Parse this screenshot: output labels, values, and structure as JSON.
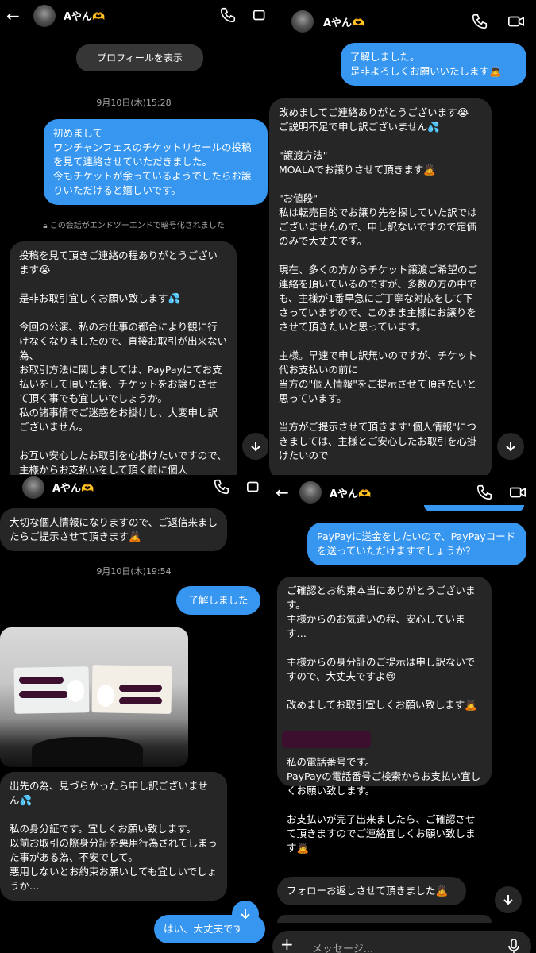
{
  "contact": {
    "name": "Aやん🫶"
  },
  "panel1": {
    "profile_button": "プロフィールを表示",
    "timestamp": "9月10日(木)15:28",
    "out_message": "初めまして\nワンチャンフェスのチケットリセールの投稿を見て連絡させていただきました。\n今もチケットが余っているようでしたらお譲りいただけると嬉しいです。",
    "encryption_notice": "この会話がエンドツーエンドで暗号化されました",
    "in_message": "投稿を見て頂きご連絡の程ありがとうございます😭\n\n是非お取引宜しくお願い致します💦\n\n今回の公演、私のお仕事の都合により観に行けなくなりましたので、直接お取引が出来ない為、\nお取引方法に関しましては、PayPayにてお支払いをして頂いた後、チケットをお譲りさせて頂く事でも宜しいでしょうか。\n私の諸事情でご迷惑をお掛けし、大変申し訳ございません。\n\nお互い安心したお取引を心掛けたいですので、主様からお支払いをして頂く前に個人"
  },
  "panel2": {
    "out_message": "了解しました。\n是非よろしくお願いいたします🙇",
    "in_message": "改めましてご連絡ありがとうございます😭\nご説明不足で申し訳ございません💦\n\n\"譲渡方法\"\nMOALAでお譲りさせて頂きます🙇\n\n\"お値段\"\n私は転売目的でお譲り先を探していた訳ではございませんので、申し訳ないですので定価のみで大丈夫です。\n\n現在、多くの方からチケット譲渡ご希望のご連絡を頂いているのですが、多数の方の中でも、主様が1番早急にご丁寧な対応をして下さっていますので、このまま主様にお譲りをさせて頂きたいと思っています。\n\n主様。早速で申し訳無いのですが、チケット代お支払いの前に\n当方の\"個人情報\"をご提示させて頂きたいと思っています。\n\n当方がご提示させて頂きます\"個人情報\"につきましては、主様とご安心したお取引を心掛けたいので"
  },
  "panel3": {
    "in_message_1": "大切な個人情報になりますので、ご返信来ましたらご提示させて頂きます🙇",
    "timestamp": "9月10日(木)19:54",
    "out_message_1": "了解しました",
    "in_message_2": "出先の為、見づらかったら申し訳ございません💦\n\n私の身分証です。宜しくお願い致します。\n以前お取引の際身分証を悪用行為されてしまった事がある為、不安でして。\n悪用しないとお約束お願いしても宜しいでしょうか…",
    "out_message_2": "はい、大丈夫です"
  },
  "panel4": {
    "out_message": "PayPayに送金をしたいので、PayPayコードを送っていただけますでしょうか？",
    "in_message_1": "ご確認とお約束本当にありがとうございます。\n主様からのお気遣いの程、安心しています…\n\n主様からの身分証のご提示は申し訳ないですので、大丈夫ですよ😢\n\n改めましてお取引宜しくお願い致します🙇\n\n\n\n私の電話番号です。\nPayPayの電話番号ご検索からお支払い宜しくお願い致します。\n\nお支払いが完了出来ましたら、ご確認させて頂きますのでご連絡宜しくお願い致します🙇",
    "in_message_2": "フォローお返しさせて頂きました🙇",
    "compose_placeholder": "メッセージ..."
  },
  "colors": {
    "outgoing": "#3797f0",
    "incoming": "#262626",
    "background": "#000000"
  }
}
